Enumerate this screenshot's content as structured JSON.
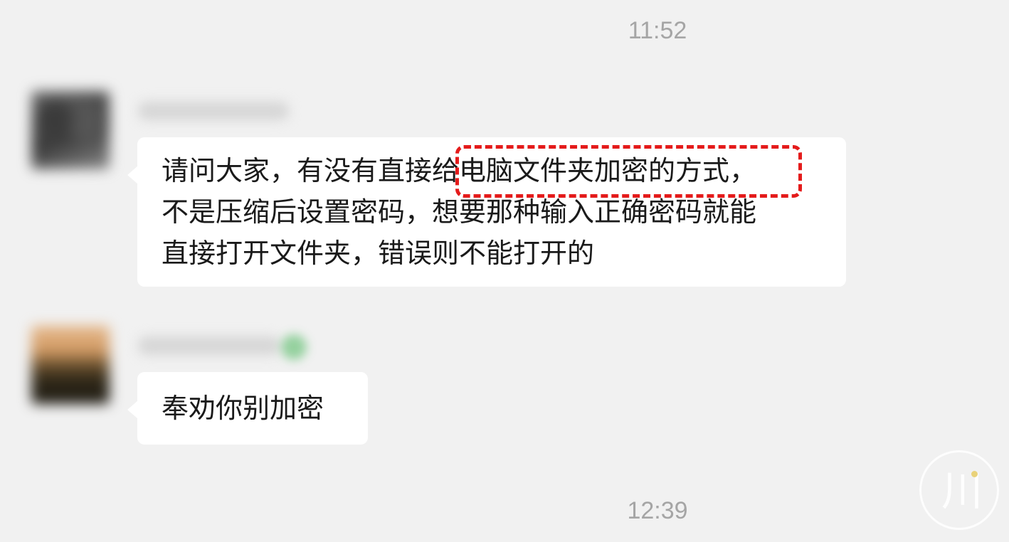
{
  "timestamps": {
    "top": "11:52",
    "bottom": "12:39"
  },
  "messages": [
    {
      "lines": [
        "请问大家，有没有直接给电脑文件夹加密的方式，",
        "不是压缩后设置密码，想要那种输入正确密码就能",
        "直接打开文件夹，错误则不能打开的"
      ]
    },
    {
      "lines": [
        "奉劝你别加密"
      ]
    }
  ],
  "highlight": {
    "color": "#e41b1b",
    "text": "给电脑文件夹加密的方式"
  },
  "colors": {
    "background": "#f1f1f1",
    "bubble": "#ffffff",
    "timestamp": "#a5a5a5",
    "online_indicator": "#7ec98a"
  },
  "watermark": {
    "glyph": "川"
  }
}
